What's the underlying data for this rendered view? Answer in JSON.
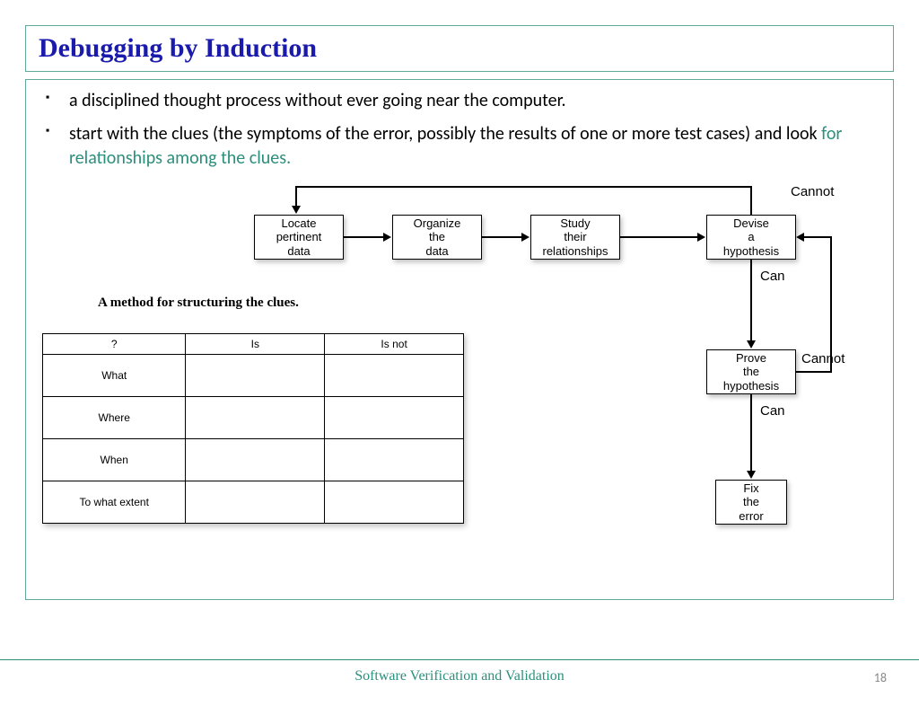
{
  "title": "Debugging by Induction",
  "bullets": {
    "b1": "a disciplined thought process without ever going near the computer.",
    "b2a": "start with the clues (the symptoms of the error, possibly the results of one or more test cases) and look ",
    "b2b": "for relationships among the clues."
  },
  "nodes": {
    "locate": "Locate\npertinent\ndata",
    "organize": "Organize\nthe\ndata",
    "study": "Study\ntheir\nrelationships",
    "devise": "Devise\na\nhypothesis",
    "prove": "Prove\nthe\nhypothesis",
    "fix": "Fix\nthe\nerror"
  },
  "labels": {
    "cannot1": "Cannot",
    "can1": "Can",
    "cannot2": "Cannot",
    "can2": "Can"
  },
  "caption": "A method for structuring the clues.",
  "table": {
    "h1": "?",
    "h2": "Is",
    "h3": "Is not",
    "r1": "What",
    "r2": "Where",
    "r3": "When",
    "r4": "To what extent"
  },
  "footer": "Software Verification and Validation",
  "page": "18"
}
